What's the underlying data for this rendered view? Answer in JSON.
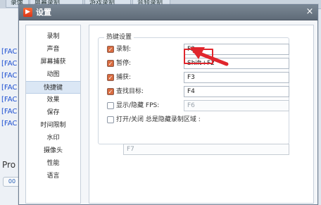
{
  "background": {
    "tabs": [
      "录像",
      "屏幕录制",
      "游戏录制",
      "音频录制"
    ],
    "left_items": [
      "[FAC",
      "[FAC",
      "[FAC",
      "[FAC",
      "[FAC",
      "[FAC",
      "[FAC"
    ],
    "pro_text": "Pro",
    "small_text": "00"
  },
  "dialog": {
    "title": "设置",
    "close_label": "×",
    "sidebar_items": [
      "录制",
      "声音",
      "屏幕捕获",
      "动图",
      "快捷键",
      "效果",
      "保存",
      "时间限制",
      "水印",
      "摄像头",
      "性能",
      "语言"
    ],
    "selected_index": 4,
    "group_title": "热键设置",
    "rows": [
      {
        "label": "录制:",
        "checked": true,
        "value": "F2",
        "disabled": false
      },
      {
        "label": "暂停:",
        "checked": true,
        "value": "Shift+F2",
        "disabled": false
      },
      {
        "label": "捕获:",
        "checked": true,
        "value": "F3",
        "disabled": false
      },
      {
        "label": "查找目标:",
        "checked": true,
        "value": "F4",
        "disabled": false
      },
      {
        "label": "显示/隐藏 FPS:",
        "checked": false,
        "value": "F6",
        "disabled": true
      }
    ],
    "region_toggle_label": "打开/关闭 总是隐藏录制区域 :",
    "region_toggle_checked": false,
    "region_field_value": "F7"
  },
  "colors": {
    "accent": "#e0262d",
    "checkbox_on": "#d86b3f"
  }
}
